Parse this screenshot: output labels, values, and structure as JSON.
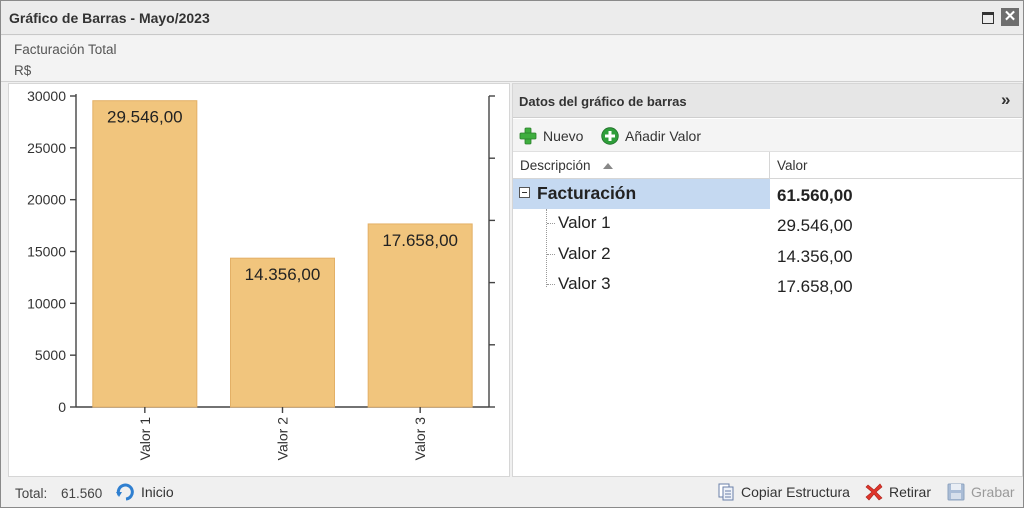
{
  "window": {
    "title": "Gráfico de Barras - Mayo/2023",
    "maximize_icon": "maximize-icon",
    "close_label": "✕"
  },
  "header": {
    "title": "Facturación Total",
    "unit": "R$"
  },
  "chart_data": {
    "type": "bar",
    "categories": [
      "Valor 1",
      "Valor 2",
      "Valor 3"
    ],
    "values": [
      29546.0,
      14356.0,
      17658.0
    ],
    "data_labels": [
      "29.546,00",
      "14.356,00",
      "17.658,00"
    ],
    "y_ticks": [
      "0",
      "5000",
      "10000",
      "15000",
      "20000",
      "25000",
      "30000"
    ],
    "ylim": [
      0,
      30000
    ],
    "bar_color": "#f1c57d",
    "title": "",
    "xlabel": "",
    "ylabel": ""
  },
  "data_panel": {
    "title": "Datos del gráfico de barras",
    "collapse_icon": "»",
    "toolbar": {
      "new_label": "Nuevo",
      "add_value_label": "Añadir Valor"
    },
    "columns": {
      "description": "Descripción",
      "value": "Valor"
    },
    "rows": [
      {
        "description": "Facturación",
        "value": "61.560,00"
      },
      {
        "description": "Valor 1",
        "value": "29.546,00"
      },
      {
        "description": "Valor 2",
        "value": "14.356,00"
      },
      {
        "description": "Valor 3",
        "value": "17.658,00"
      }
    ],
    "selection_color": "#c5d9f1"
  },
  "footer": {
    "total_label": "Total:",
    "total_value": "61.560",
    "home_label": "Inicio",
    "copy_label": "Copiar Estructura",
    "remove_label": "Retirar",
    "save_label": "Grabar"
  }
}
